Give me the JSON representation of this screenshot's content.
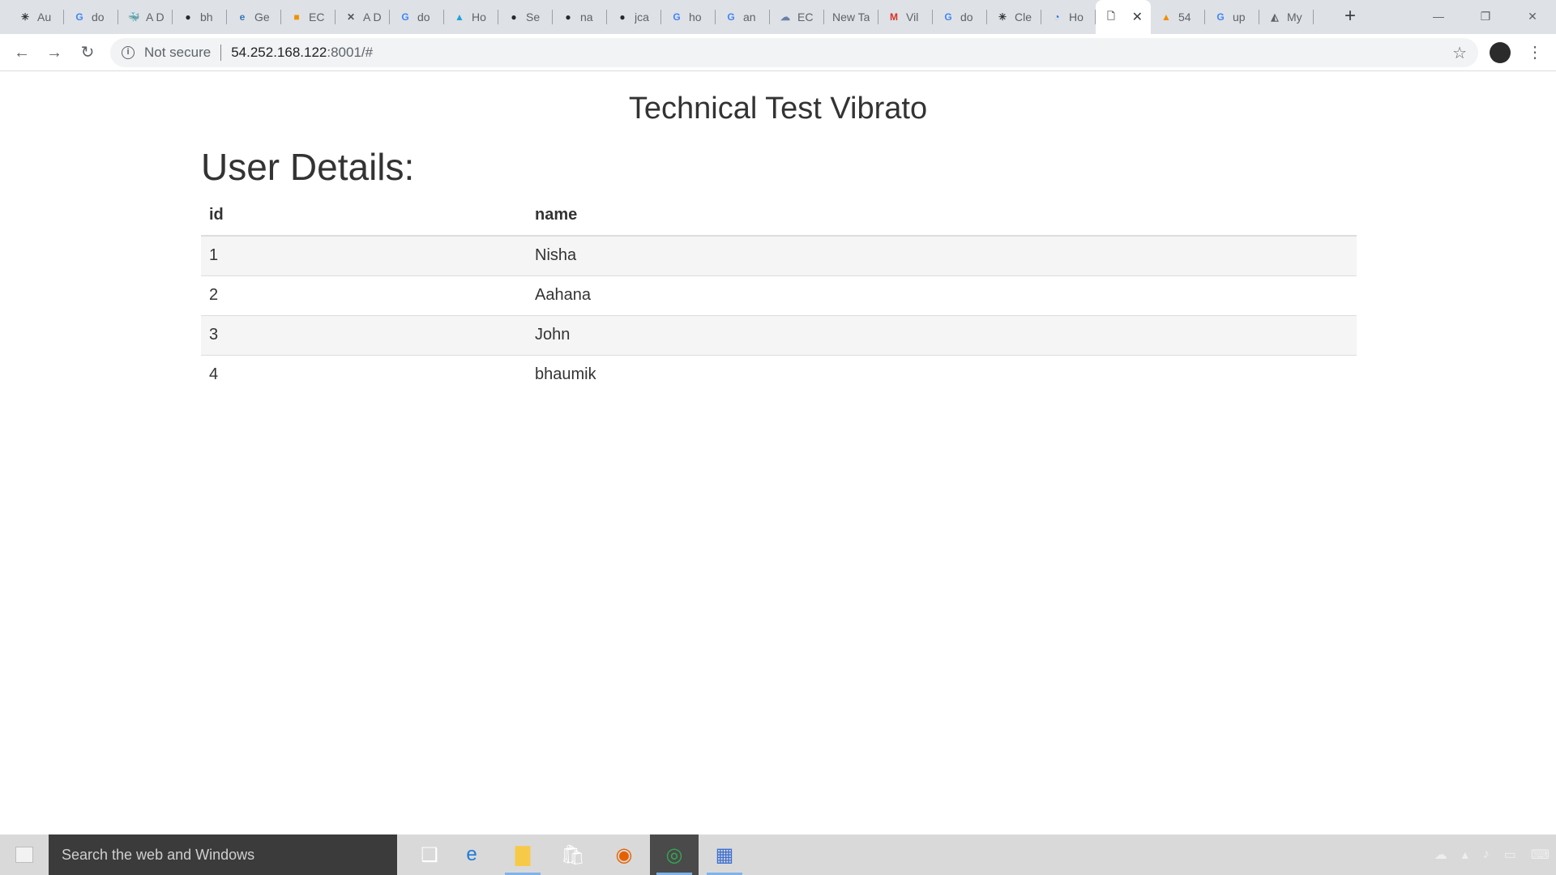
{
  "browser": {
    "tabs": [
      {
        "title": "Au",
        "favicon": "auth0-icon",
        "color": "#333333",
        "glyph": "✳"
      },
      {
        "title": "do",
        "favicon": "google-icon",
        "color": "#4285f4",
        "glyph": "G"
      },
      {
        "title": "A D",
        "favicon": "docker-icon",
        "color": "#2496ed",
        "glyph": "🐳"
      },
      {
        "title": "bh",
        "favicon": "github-icon",
        "color": "#24292e",
        "glyph": "●"
      },
      {
        "title": "Ge",
        "favicon": "edge-icon",
        "color": "#3277bc",
        "glyph": "e"
      },
      {
        "title": "EC",
        "favicon": "aws-box-icon",
        "color": "#f29100",
        "glyph": "■"
      },
      {
        "title": "A D",
        "favicon": "tools-icon",
        "color": "#555555",
        "glyph": "✕"
      },
      {
        "title": "do",
        "favicon": "google-icon",
        "color": "#4285f4",
        "glyph": "G"
      },
      {
        "title": "Ho",
        "favicon": "hashicorp-icon",
        "color": "#1fa3dd",
        "glyph": "▲"
      },
      {
        "title": "Se",
        "favicon": "github-icon",
        "color": "#24292e",
        "glyph": "●"
      },
      {
        "title": "na",
        "favicon": "github-icon",
        "color": "#24292e",
        "glyph": "●"
      },
      {
        "title": "jca",
        "favicon": "github-icon",
        "color": "#24292e",
        "glyph": "●"
      },
      {
        "title": "ho",
        "favicon": "google-icon",
        "color": "#4285f4",
        "glyph": "G"
      },
      {
        "title": "an",
        "favicon": "google-icon",
        "color": "#4285f4",
        "glyph": "G"
      },
      {
        "title": "EC",
        "favicon": "cloud-icon",
        "color": "#6b7fa8",
        "glyph": "☁"
      },
      {
        "title": "New Ta",
        "favicon": "",
        "color": "",
        "glyph": ""
      },
      {
        "title": "Vil",
        "favicon": "gmail-icon",
        "color": "#d93025",
        "glyph": "M"
      },
      {
        "title": "do",
        "favicon": "google-icon",
        "color": "#4285f4",
        "glyph": "G"
      },
      {
        "title": "Cle",
        "favicon": "auth0-icon",
        "color": "#333333",
        "glyph": "✳"
      },
      {
        "title": "Ho",
        "favicon": "openshift-icon",
        "color": "#1a73e8",
        "glyph": "◔"
      },
      {
        "title": "",
        "favicon": "document-icon",
        "color": "#5f6368",
        "glyph": "🗋",
        "active": true
      },
      {
        "title": "54",
        "favicon": "phpmyadmin-icon",
        "color": "#f48c00",
        "glyph": "▲"
      },
      {
        "title": "up",
        "favicon": "google-icon",
        "color": "#4285f4",
        "glyph": "G"
      },
      {
        "title": "My",
        "favicon": "mydrive-icon",
        "color": "#5f6368",
        "glyph": "◭"
      }
    ],
    "new_tab_label": "+",
    "window_controls": {
      "minimize": "—",
      "maximize": "❐",
      "close": "✕"
    },
    "nav": {
      "back": "←",
      "forward": "→",
      "reload": "↻"
    },
    "address_bar": {
      "security_label": "Not secure",
      "url_host": "54.252.168.122",
      "url_rest": ":8001/#"
    },
    "star_glyph": "☆",
    "menu_glyph": "⋮"
  },
  "page": {
    "title": "Technical Test Vibrato",
    "heading": "User Details:",
    "table": {
      "columns": [
        "id",
        "name"
      ],
      "rows": [
        [
          "1",
          "Nisha"
        ],
        [
          "2",
          "Aahana"
        ],
        [
          "3",
          "John"
        ],
        [
          "4",
          "bhaumik"
        ]
      ]
    }
  },
  "taskbar": {
    "search_placeholder": "Search the web and Windows",
    "apps": [
      {
        "name": "task-view-icon",
        "glyph": "❑",
        "color": "#ffffff",
        "running": false,
        "active": false
      },
      {
        "name": "edge-taskbar-icon",
        "glyph": "e",
        "color": "#1e7bd8",
        "running": false,
        "active": false
      },
      {
        "name": "file-explorer-icon",
        "glyph": "▇",
        "color": "#f7c948",
        "running": true,
        "active": false
      },
      {
        "name": "store-icon",
        "glyph": "🛍",
        "color": "#ffffff",
        "running": false,
        "active": false
      },
      {
        "name": "firefox-icon",
        "glyph": "◉",
        "color": "#e66000",
        "running": false,
        "active": false
      },
      {
        "name": "chrome-icon",
        "glyph": "◎",
        "color": "#34a853",
        "running": true,
        "active": true
      },
      {
        "name": "network-app-icon",
        "glyph": "▦",
        "color": "#3d6fd1",
        "running": true,
        "active": false
      }
    ],
    "tray_icons": [
      "cloud-tray-icon",
      "network-tray-icon",
      "volume-tray-icon",
      "notification-tray-icon",
      "keyboard-tray-icon"
    ]
  }
}
